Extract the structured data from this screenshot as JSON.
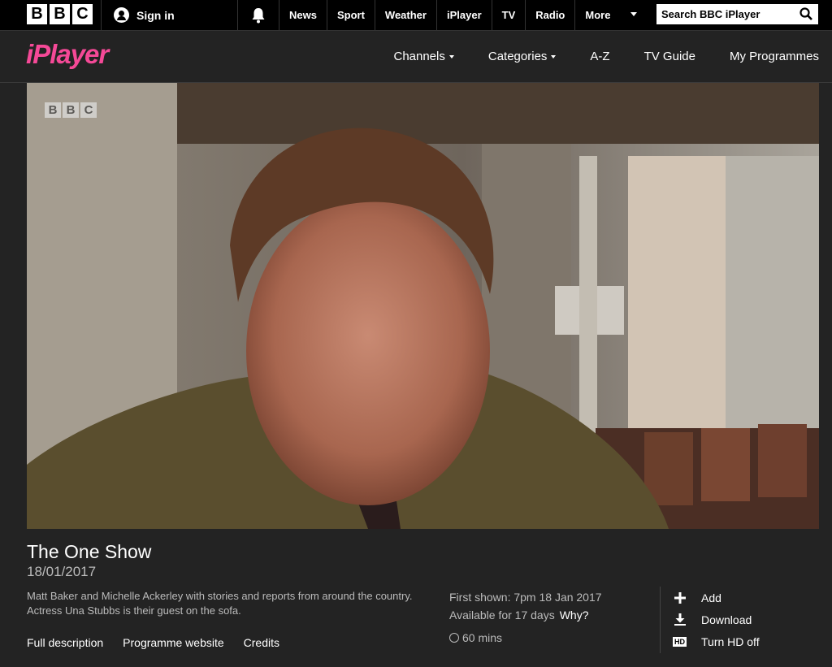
{
  "bbc_bar": {
    "logo_letters": [
      "B",
      "B",
      "C"
    ],
    "sign_in": "Sign in",
    "nav": [
      "News",
      "Sport",
      "Weather",
      "iPlayer",
      "TV",
      "Radio",
      "More"
    ],
    "search_placeholder": "Search BBC iPlayer"
  },
  "iplayer_header": {
    "logo": "iPlayer",
    "nav": {
      "channels": "Channels",
      "categories": "Categories",
      "az": "A-Z",
      "tv_guide": "TV Guide",
      "my_programmes": "My Programmes"
    }
  },
  "video": {
    "watermark_letters": [
      "B",
      "B",
      "C"
    ]
  },
  "programme": {
    "title": "The One Show",
    "date": "18/01/2017",
    "description": "Matt Baker and Michelle Ackerley with stories and reports from around the country. Actress Una Stubbs is their guest on the sofa.",
    "links": {
      "full_description": "Full description",
      "programme_website": "Programme website",
      "credits": "Credits"
    },
    "first_shown": "First shown: 7pm 18 Jan 2017",
    "availability": "Available for 17 days",
    "why": "Why?",
    "duration": "60 mins"
  },
  "actions": {
    "add": "Add",
    "download": "Download",
    "hd_badge": "HD",
    "hd_toggle": "Turn HD off"
  },
  "colors": {
    "accent_pink": "#f54997",
    "background": "#232323",
    "top_bar": "#000000"
  }
}
